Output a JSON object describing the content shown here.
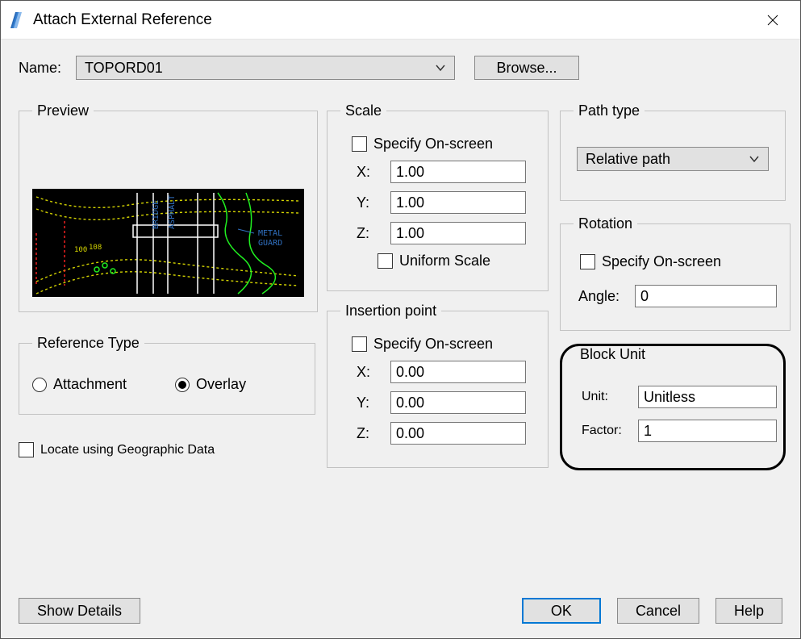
{
  "window": {
    "title": "Attach External Reference"
  },
  "name": {
    "label": "Name:",
    "value": "TOPORD01",
    "browse": "Browse..."
  },
  "preview": {
    "legend": "Preview",
    "cad_labels": {
      "asphalt": "ASPHALT",
      "bridge": "BRIDGE",
      "metal": "METAL",
      "guard": "GUARD"
    }
  },
  "scale": {
    "legend": "Scale",
    "specify": "Specify On-screen",
    "x_label": "X:",
    "y_label": "Y:",
    "z_label": "Z:",
    "x": "1.00",
    "y": "1.00",
    "z": "1.00",
    "uniform": "Uniform Scale"
  },
  "insertion": {
    "legend": "Insertion point",
    "specify": "Specify On-screen",
    "x_label": "X:",
    "y_label": "Y:",
    "z_label": "Z:",
    "x": "0.00",
    "y": "0.00",
    "z": "0.00"
  },
  "reftype": {
    "legend": "Reference Type",
    "attachment": "Attachment",
    "overlay": "Overlay",
    "selected": "overlay"
  },
  "locate": {
    "label": "Locate using Geographic Data"
  },
  "pathtype": {
    "legend": "Path type",
    "value": "Relative path"
  },
  "rotation": {
    "legend": "Rotation",
    "specify": "Specify On-screen",
    "angle_label": "Angle:",
    "angle": "0"
  },
  "blockunit": {
    "legend": "Block Unit",
    "unit_label": "Unit:",
    "unit": "Unitless",
    "factor_label": "Factor:",
    "factor": "1"
  },
  "footer": {
    "show_details": "Show Details",
    "ok": "OK",
    "cancel": "Cancel",
    "help": "Help"
  }
}
